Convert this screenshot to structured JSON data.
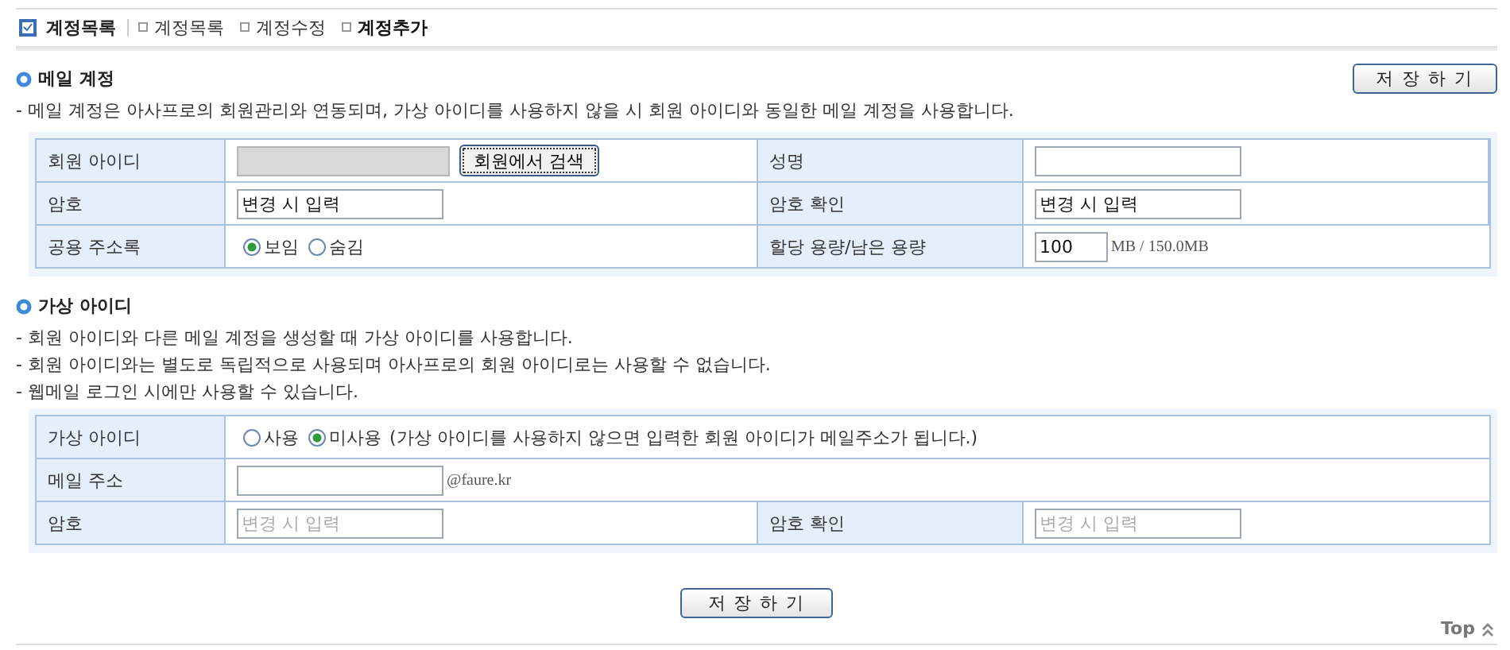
{
  "nav": {
    "title": "계정목록",
    "links": [
      {
        "label": "계정목록",
        "selected": false
      },
      {
        "label": "계정수정",
        "selected": false
      },
      {
        "label": "계정추가",
        "selected": true
      }
    ]
  },
  "sections": [
    {
      "title": "메일 계정",
      "save_button": "저 장 하 기",
      "notes": [
        "- 메일 계정은 아사프로의 회원관리와 연동되며, 가상 아이디를 사용하지 않을 시 회원 아이디와 동일한 메일 계정을 사용합니다."
      ],
      "rows": [
        [
          {
            "label": "회원 아이디",
            "kind": "search",
            "disabled": true,
            "button": "회원에서 검색"
          },
          {
            "label": "성명",
            "kind": "text"
          }
        ],
        [
          {
            "label": "암호",
            "kind": "text",
            "value": "변경 시 입력"
          },
          {
            "label": "암호 확인",
            "kind": "text",
            "value": "변경 시 입력"
          }
        ],
        [
          {
            "label": "공용 주소록",
            "kind": "radio",
            "options": [
              {
                "label": "보임",
                "selected": true
              },
              {
                "label": "숨김",
                "selected": false
              }
            ]
          },
          {
            "label": "할당 용량/남은 용량",
            "kind": "quota",
            "value": "100",
            "suffix": "MB / 150.0MB"
          }
        ]
      ]
    },
    {
      "title": "가상 아이디",
      "notes": [
        "- 회원 아이디와 다른 메일 계정을 생성할 때 가상 아이디를 사용합니다.",
        "- 회원 아이디와는 별도로 독립적으로 사용되며 아사프로의 회원 아이디로는 사용할 수 없습니다.",
        "- 웹메일 로그인 시에만 사용할 수 있습니다."
      ],
      "rows": [
        [
          {
            "label": "가상 아이디",
            "kind": "radio",
            "options": [
              {
                "label": "사용",
                "selected": false
              },
              {
                "label": "미사용",
                "selected": true
              }
            ],
            "note": "(가상 아이디를 사용하지 않으면 입력한 회원 아이디가 메일주소가 됩니다.)"
          }
        ],
        [
          {
            "label": "메일 주소",
            "kind": "email",
            "suffix": "@faure.kr"
          }
        ],
        [
          {
            "label": "암호",
            "kind": "text",
            "placeholder": "변경 시 입력"
          },
          {
            "label": "암호 확인",
            "kind": "text",
            "placeholder": "변경 시 입력"
          }
        ]
      ]
    }
  ],
  "footer": {
    "save_button": "저 장 하 기",
    "top_link": "Top"
  }
}
